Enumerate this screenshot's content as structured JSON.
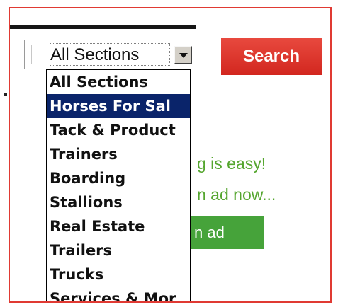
{
  "section_select": {
    "selected_value": "All Sections",
    "options": [
      "All Sections",
      "Horses For Sal",
      "Tack & Product",
      "Trainers",
      "Boarding",
      "Stallions",
      "Real Estate",
      "Trailers",
      "Trucks",
      "Services & Mor"
    ],
    "highlighted_index": 1
  },
  "search_button": {
    "label": "Search"
  },
  "promo": {
    "line1": "g is easy!",
    "line2": "n ad now...",
    "button_label": "n ad"
  },
  "colors": {
    "frame_border": "#e03a33",
    "search_bg": "#d2271f",
    "promo_text": "#55a62f",
    "promo_button_bg": "#46a33a",
    "selected_bg": "#0a246a"
  },
  "icons": {
    "dropdown_arrow": "chevron-down-icon"
  }
}
